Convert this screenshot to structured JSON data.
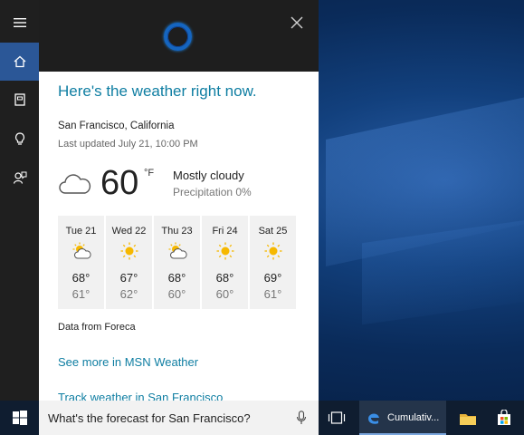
{
  "rail": {
    "items": [
      {
        "icon": "hamburger-menu-icon"
      },
      {
        "icon": "home-icon"
      },
      {
        "icon": "notebook-icon"
      },
      {
        "icon": "lightbulb-icon"
      },
      {
        "icon": "feedback-icon"
      }
    ]
  },
  "panel": {
    "heading": "Here's the weather right now.",
    "location": "San Francisco, California",
    "last_updated": "Last updated July 21, 10:00 PM",
    "current": {
      "temperature": "60",
      "unit": "°F",
      "condition": "Mostly cloudy",
      "precipitation": "Precipitation 0%",
      "icon": "cloud-icon"
    },
    "forecast": [
      {
        "day": "Tue 21",
        "high": "68°",
        "low": "61°",
        "icon": "partly-sunny-icon"
      },
      {
        "day": "Wed 22",
        "high": "67°",
        "low": "62°",
        "icon": "sunny-icon"
      },
      {
        "day": "Thu 23",
        "high": "68°",
        "low": "60°",
        "icon": "partly-sunny-icon"
      },
      {
        "day": "Fri 24",
        "high": "68°",
        "low": "60°",
        "icon": "sunny-icon"
      },
      {
        "day": "Sat 25",
        "high": "69°",
        "low": "61°",
        "icon": "sunny-icon"
      }
    ],
    "source": "Data from Foreca",
    "link_more": "See more in MSN Weather",
    "link_track": "Track weather in San Francisco"
  },
  "taskbar": {
    "search_value": "What's the forecast for San Francisco?",
    "edge_label": "Cumulativ..."
  },
  "colors": {
    "accent": "#0f7ea2",
    "rail_active": "#2b5797",
    "cortana_ring": "#1565c0"
  }
}
